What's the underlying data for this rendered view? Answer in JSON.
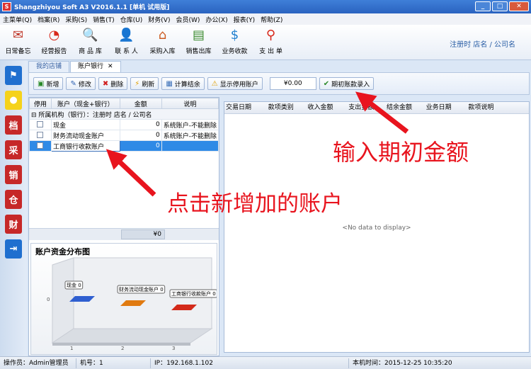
{
  "window": {
    "title": "Shangzhiyou Soft A3 V2016.1.1 [单机 试用版]",
    "btn_min": "_",
    "btn_max": "□",
    "btn_close": "✕"
  },
  "menu": [
    "主菜单(Q)",
    "档案(R)",
    "采购(S)",
    "销售(T)",
    "仓库(U)",
    "财务(V)",
    "会员(W)",
    "办公(X)",
    "报表(Y)",
    "帮助(Z)"
  ],
  "toolbar": [
    {
      "label": "日常备忘",
      "icon": "mail-icon",
      "glyph": "✉",
      "color": "#c0392b"
    },
    {
      "label": "经营报告",
      "icon": "pie-chart-icon",
      "glyph": "◔",
      "color": "#d8291c"
    },
    {
      "label": "商 品 库",
      "icon": "magnifier-icon",
      "glyph": "🔍",
      "color": "#3a6fb8"
    },
    {
      "label": "联 系 人",
      "icon": "contact-icon",
      "glyph": "👤",
      "color": "#c0392b"
    },
    {
      "label": "采购入库",
      "icon": "house-icon",
      "glyph": "⌂",
      "color": "#cc5a20"
    },
    {
      "label": "销售出库",
      "icon": "money-icon",
      "glyph": "▤",
      "color": "#3a8a2e"
    },
    {
      "label": "业务收款",
      "icon": "dollar-icon",
      "glyph": "$",
      "color": "#1f7fcf"
    },
    {
      "label": "支 出 单",
      "icon": "pin-icon",
      "glyph": "⚲",
      "color": "#d8291c"
    }
  ],
  "shop_name": "注册时 店名 / 公司名",
  "sidebar": [
    {
      "name": "flag-icon",
      "glyph": "⚑",
      "color": "#1f6fcf"
    },
    {
      "name": "bulb-icon",
      "glyph": "●",
      "color": "#e5b100"
    },
    {
      "name": "sidebar-dang-icon",
      "glyph": "档",
      "color": "#c62828"
    },
    {
      "name": "sidebar-cai-icon",
      "glyph": "采",
      "color": "#c62828"
    },
    {
      "name": "sidebar-xiao-icon",
      "glyph": "销",
      "color": "#c62828"
    },
    {
      "name": "sidebar-cang-icon",
      "glyph": "仓",
      "color": "#c62828"
    },
    {
      "name": "sidebar-cai2-icon",
      "glyph": "财",
      "color": "#c62828"
    },
    {
      "name": "exit-icon",
      "glyph": "⇥",
      "color": "#1f6fcf"
    }
  ],
  "tabs": [
    {
      "label": "我的店铺"
    },
    {
      "label": "账户银行",
      "close": "✕"
    }
  ],
  "actions": {
    "add": "新增",
    "edit": "修改",
    "delete": "删除",
    "refresh": "刷新",
    "calc": "计算结余",
    "show_disabled": "显示停用账户",
    "amount": "¥0.00",
    "opening": "期初账款录入"
  },
  "accounts": {
    "headers": [
      "停用",
      "账户（现金+银行）",
      "金额",
      "说明"
    ],
    "group": "所属机构（银行）：注册时 店名 / 公司名",
    "rows": [
      {
        "name": "现金",
        "amount": "0",
        "note": "系统账户-不能删除"
      },
      {
        "name": "财务流动现金账户",
        "amount": "0",
        "note": "系统账户-不能删除"
      },
      {
        "name": "工商银行收款账户",
        "amount": "0",
        "note": ""
      }
    ],
    "total": "¥0"
  },
  "chart_data": {
    "type": "bar",
    "title": "账户资金分布图",
    "categories": [
      "1",
      "2",
      "3"
    ],
    "series": [
      {
        "name": "",
        "values": [
          0,
          0,
          0
        ]
      }
    ],
    "labels": [
      "现金 0",
      "财务流动现金账户 0",
      "工商银行收款账户 0"
    ],
    "yticks": [
      "0"
    ],
    "bar_colors": [
      "#2f5fd0",
      "#e07a10",
      "#d32a1a"
    ]
  },
  "transactions": {
    "headers": [
      "交易日期",
      "款项类别",
      "收入金额",
      "支出金额",
      "结余金额",
      "业务日期",
      "款项说明"
    ],
    "empty": "<No data to display>"
  },
  "annotations": {
    "top": "输入期初金额",
    "bottom": "点击新增加的账户"
  },
  "status": {
    "operator": "操作员：Admin管理员",
    "machine": "机号：1",
    "ip": "IP：192.168.1.102",
    "time": "本机时间：2015-12-25 10:35:20"
  }
}
